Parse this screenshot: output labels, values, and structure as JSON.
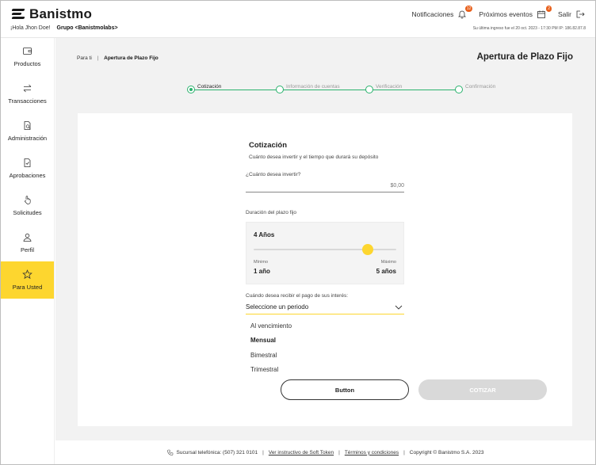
{
  "header": {
    "brand": "Banistmo",
    "greeting": "¡Hola Jhon Doe!",
    "group": "Grupo <Banistmolabs>",
    "notifications_label": "Notificaciones",
    "notifications_count": "12",
    "events_label": "Próximos eventos",
    "events_count": "2",
    "logout_label": "Salir",
    "last_login": "Su última ingreso fue el 20 oct. 2023 - 17:30 PM IP: 186.82.87.8"
  },
  "sidebar": {
    "items": [
      {
        "label": "Productos",
        "icon": "wallet-icon"
      },
      {
        "label": "Transacciones",
        "icon": "arrows-icon"
      },
      {
        "label": "Administración",
        "icon": "document-search-icon"
      },
      {
        "label": "Aprobaciones",
        "icon": "document-check-icon"
      },
      {
        "label": "Solicitudes",
        "icon": "hand-pointer-icon"
      },
      {
        "label": "Perfil",
        "icon": "user-icon"
      },
      {
        "label": "Para Usted",
        "icon": "star-icon"
      }
    ],
    "active_index": 6
  },
  "breadcrumb": {
    "root": "Para ti",
    "separator": "|",
    "current": "Apertura de Plazo Fijo"
  },
  "page_title": "Apertura de Plazo Fijo",
  "stepper": {
    "steps": [
      "Cotización",
      "Información de cuentas",
      "Verificación",
      "Confirmación"
    ],
    "active_index": 0
  },
  "form": {
    "title": "Cotización",
    "subtitle": "Cuánto desea invertir y el tiempo que durará su depósito",
    "amount_label": "¿Cuánto desea invertir?",
    "amount_placeholder": "$0,00",
    "duration_label": "Duración del plazo fijo",
    "duration_value": "4 Años",
    "duration_min_label": "Mínimo",
    "duration_min_value": "1 año",
    "duration_max_label": "Máximo",
    "duration_max_value": "5 años",
    "duration_level": 0.8,
    "interest_label": "Cuándo desea recibir el pago de sus interés:",
    "interest_placeholder": "Seleccione un periodo",
    "interest_options": [
      "Al vencimiento",
      "Mensual",
      "Bimestral",
      "Trimestral"
    ],
    "interest_highlighted_index": 1
  },
  "actions": {
    "secondary_label": "Button",
    "primary_label": "COTIZAR"
  },
  "footer": {
    "phone": "Sucursal telefónica: (507) 321 0101",
    "soft_token_link": "Ver instructivo de Soft Token",
    "terms_link": "Términos y condiciones",
    "copyright": "Copyright © Banistmo S.A. 2023"
  },
  "colors": {
    "accent_yellow": "#fdd62f",
    "stepper_green": "#2bb26e",
    "badge_orange": "#e8601c",
    "disabled_gray": "#d9d9d9"
  }
}
